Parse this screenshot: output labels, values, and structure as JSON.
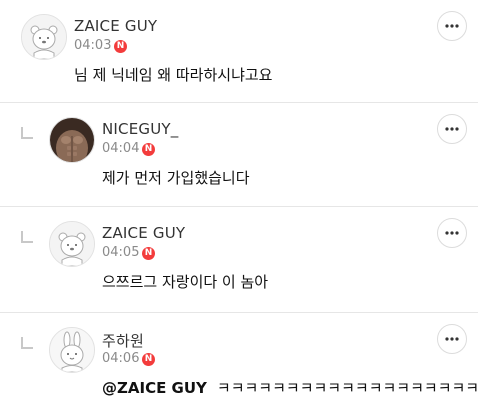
{
  "comments": [
    {
      "nickname": "ZAICE GUY",
      "time": "04:03",
      "badge": "N",
      "text": "님 제 닉네임 왜 따라하시냐고요",
      "avatar_icon": "bear-avatar-icon",
      "is_reply": false
    },
    {
      "nickname": "NICEGUY_",
      "time": "04:04",
      "badge": "N",
      "text": "제가 먼저 가입했습니다",
      "avatar_icon": "photo-avatar-icon",
      "is_reply": true
    },
    {
      "nickname": "ZAICE GUY",
      "time": "04:05",
      "badge": "N",
      "text": "으쯔르그 자랑이다 이 놈아",
      "avatar_icon": "bear-avatar-icon",
      "is_reply": true
    },
    {
      "nickname": "주하원",
      "time": "04:06",
      "badge": "N",
      "mention": "@ZAICE GUY",
      "text": "ㅋㅋㅋㅋㅋㅋㅋㅋㅋㅋㅋㅋㅋㅋㅋㅋㅋㅋㅋ",
      "avatar_icon": "rabbit-avatar-icon",
      "is_reply": true
    }
  ],
  "colors": {
    "new_badge": "#f33c3c",
    "divider": "#e6e6e6",
    "time_text": "#8a8a8a"
  }
}
